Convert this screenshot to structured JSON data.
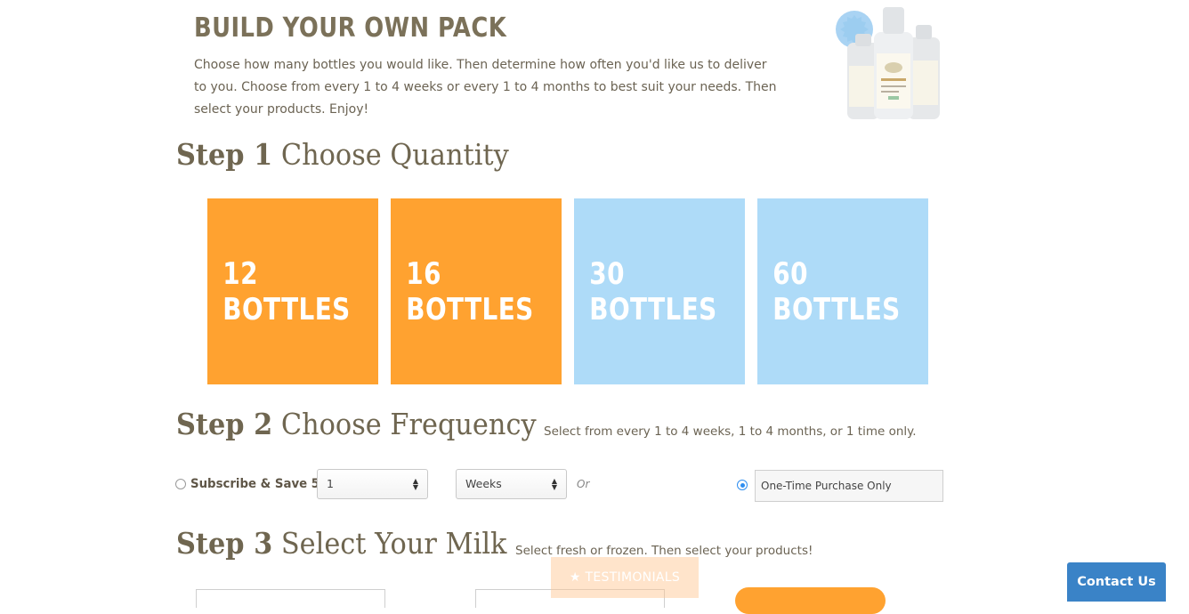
{
  "header": {
    "title": "BUILD YOUR OWN PACK",
    "intro": "Choose how many bottles you would like. Then determine how often you'd like us to deliver to you. Choose from every 1 to 4 weeks or every 1 to 4 months to best suit your needs. Then select your products. Enjoy!"
  },
  "step1": {
    "step": "Step 1",
    "title": "Choose Quantity",
    "tiles": [
      {
        "label": "12 BOTTLES",
        "color": "#ffa230"
      },
      {
        "label": "16 BOTTLES",
        "color": "#ffa230"
      },
      {
        "label": "30 BOTTLES",
        "color": "#aedbf8"
      },
      {
        "label": "60 BOTTLES",
        "color": "#aedbf8"
      }
    ]
  },
  "step2": {
    "step": "Step 2",
    "title": "Choose Frequency",
    "subtitle": "Select from every 1 to 4 weeks, 1 to 4 months, or 1 time only.",
    "subscribe_label": "Subscribe & Save 5%:",
    "quantity_select": "1",
    "interval_select": "Weeks",
    "or_text": "Or",
    "onetime_label": "One-Time Purchase Only"
  },
  "step3": {
    "step": "Step 3",
    "title": "Select Your Milk",
    "subtitle": "Select fresh or frozen. Then select your products!"
  },
  "floating": {
    "testimonials": "★ TESTIMONIALS",
    "contact": "Contact Us"
  },
  "colors": {
    "accent_orange": "#ffa230",
    "accent_blue": "#aedbf8",
    "contact_blue": "#3a83c7"
  }
}
